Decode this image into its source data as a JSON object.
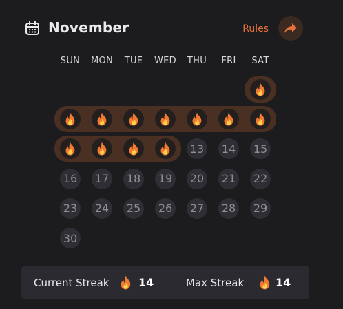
{
  "header": {
    "month": "November",
    "rules_label": "Rules",
    "calendar_icon": "calendar-icon",
    "share_icon": "share-arrow-icon"
  },
  "weekdays": [
    "SUN",
    "MON",
    "TUE",
    "WED",
    "THU",
    "FRI",
    "SAT"
  ],
  "calendar": {
    "first_weekday_index": 6,
    "days_in_month": 30,
    "streak_days": [
      1,
      2,
      3,
      4,
      5,
      6,
      7,
      8,
      9,
      10,
      11,
      12
    ],
    "streak_icon": "fire-icon"
  },
  "footer": {
    "current_streak_label": "Current Streak",
    "current_streak_value": "14",
    "max_streak_label": "Max Streak",
    "max_streak_value": "14"
  },
  "colors": {
    "accent": "#e4703a",
    "background": "#1c1b1d",
    "streak_band": "#4a3022",
    "day_circle": "#2f2e34"
  }
}
